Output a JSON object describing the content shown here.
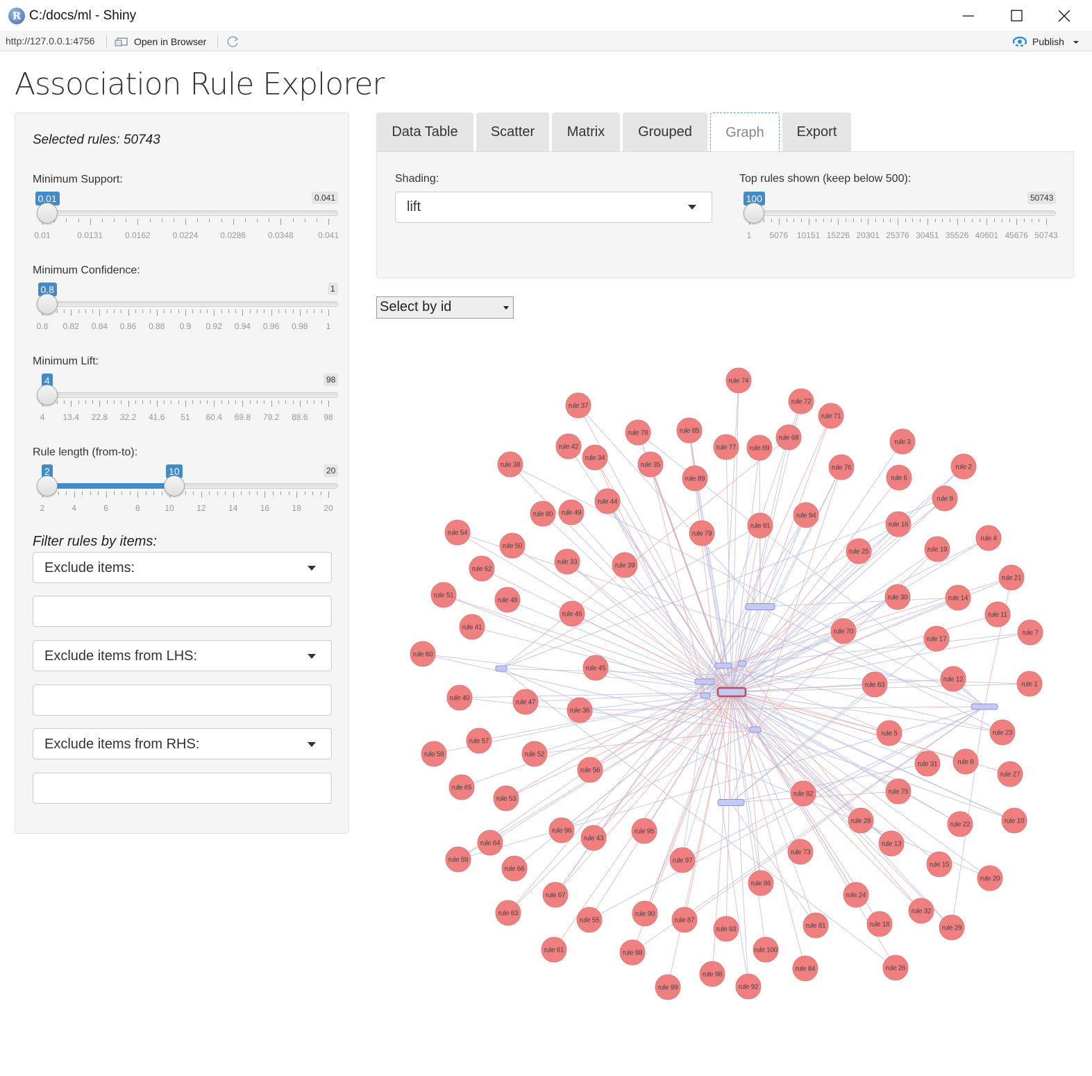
{
  "window": {
    "title": "C:/docs/ml - Shiny",
    "app_icon_letter": "R",
    "url": "http://127.0.0.1:4756",
    "open_in_browser": "Open in Browser",
    "publish": "Publish"
  },
  "page": {
    "title": "Association Rule Explorer"
  },
  "sidebar": {
    "selected_rules": "Selected rules: 50743",
    "min_support": {
      "label": "Minimum Support:",
      "value": "0.01",
      "max": "0.041",
      "value_fraction": 0.0,
      "ticks": [
        "0.01",
        "0.0131",
        "0.0162",
        "0.0224",
        "0.0286",
        "0.0348",
        "0.041"
      ]
    },
    "min_confidence": {
      "label": "Minimum Confidence:",
      "value": "0.8",
      "max": "1",
      "value_fraction": 0.0,
      "ticks": [
        "0.8",
        "0.82",
        "0.84",
        "0.86",
        "0.88",
        "0.9",
        "0.92",
        "0.94",
        "0.96",
        "0.98",
        "1"
      ]
    },
    "min_lift": {
      "label": "Minimum Lift:",
      "value": "4",
      "max": "98",
      "value_fraction": 0.0,
      "ticks": [
        "4",
        "13.4",
        "22.8",
        "32.2",
        "41.6",
        "51",
        "60.4",
        "69.8",
        "79.2",
        "88.6",
        "98"
      ]
    },
    "rule_length": {
      "label": "Rule length (from-to):",
      "from": "2",
      "to": "10",
      "max": "20",
      "from_fraction": 0.0,
      "to_fraction": 0.4444,
      "ticks": [
        "2",
        "4",
        "6",
        "8",
        "10",
        "12",
        "14",
        "16",
        "18",
        "20"
      ]
    },
    "filter_title": "Filter rules by items:",
    "exclude_items": "Exclude items:",
    "exclude_lhs": "Exclude items from LHS:",
    "exclude_rhs": "Exclude items from RHS:"
  },
  "tabs": [
    {
      "label": "Data Table",
      "active": false
    },
    {
      "label": "Scatter",
      "active": false
    },
    {
      "label": "Matrix",
      "active": false
    },
    {
      "label": "Grouped",
      "active": false
    },
    {
      "label": "Graph",
      "active": true
    },
    {
      "label": "Export",
      "active": false
    }
  ],
  "graph_options": {
    "shading_label": "Shading:",
    "shading_value": "lift",
    "top_rules_label": "Top rules shown (keep below 500):",
    "top_rules_value": "100",
    "top_rules_max": "50743",
    "top_rules_fraction": 0.0,
    "top_rules_ticks": [
      "1",
      "5076",
      "10151",
      "15226",
      "20301",
      "25376",
      "30451",
      "35526",
      "40601",
      "45676",
      "50743"
    ]
  },
  "select_by_id": "Select by id",
  "colors": {
    "accent": "#428bca",
    "rule_node": "#f08080",
    "item_node": "#c4c8f5",
    "edge_blue": "#b4b8e6",
    "edge_red": "#e6a8a8"
  },
  "network": {
    "rules": [
      {
        "label": "rule 74"
      },
      {
        "label": "rule 37"
      },
      {
        "label": "rule 72"
      },
      {
        "label": "rule 71"
      },
      {
        "label": "rule 78"
      },
      {
        "label": "rule 85"
      },
      {
        "label": "rule 68"
      },
      {
        "label": "rule 42"
      },
      {
        "label": "rule 34"
      },
      {
        "label": "rule 77"
      },
      {
        "label": "rule 69"
      },
      {
        "label": "rule 3"
      },
      {
        "label": "rule 38"
      },
      {
        "label": "rule 35"
      },
      {
        "label": "rule 89"
      },
      {
        "label": "rule 76"
      },
      {
        "label": "rule 2"
      },
      {
        "label": "rule 6"
      },
      {
        "label": "rule 44"
      },
      {
        "label": "rule 9"
      },
      {
        "label": "rule 80"
      },
      {
        "label": "rule 49"
      },
      {
        "label": "rule 94"
      },
      {
        "label": "rule 16"
      },
      {
        "label": "rule 54"
      },
      {
        "label": "rule 79"
      },
      {
        "label": "rule 91"
      },
      {
        "label": "rule 4"
      },
      {
        "label": "rule 50"
      },
      {
        "label": "rule 25"
      },
      {
        "label": "rule 19"
      },
      {
        "label": "rule 33"
      },
      {
        "label": "rule 39"
      },
      {
        "label": "rule 62"
      },
      {
        "label": "rule 21"
      },
      {
        "label": "rule 51"
      },
      {
        "label": "rule 48"
      },
      {
        "label": "rule 30"
      },
      {
        "label": "rule 14"
      },
      {
        "label": "rule 46"
      },
      {
        "label": "rule 11"
      },
      {
        "label": "rule 41"
      },
      {
        "label": "rule 70"
      },
      {
        "label": "rule 7"
      },
      {
        "label": "rule 17"
      },
      {
        "label": "rule 60"
      },
      {
        "label": "rule 45"
      },
      {
        "label": "rule 12"
      },
      {
        "label": "rule 83"
      },
      {
        "label": "rule 1"
      },
      {
        "label": "rule 40"
      },
      {
        "label": "rule 47"
      },
      {
        "label": "rule 36"
      },
      {
        "label": "rule 5"
      },
      {
        "label": "rule 23"
      },
      {
        "label": "rule 57"
      },
      {
        "label": "rule 58"
      },
      {
        "label": "rule 52"
      },
      {
        "label": "rule 31"
      },
      {
        "label": "rule 8"
      },
      {
        "label": "rule 56"
      },
      {
        "label": "rule 27"
      },
      {
        "label": "rule 65"
      },
      {
        "label": "rule 75"
      },
      {
        "label": "rule 53"
      },
      {
        "label": "rule 82"
      },
      {
        "label": "rule 28"
      },
      {
        "label": "rule 10"
      },
      {
        "label": "rule 96"
      },
      {
        "label": "rule 43"
      },
      {
        "label": "rule 95"
      },
      {
        "label": "rule 22"
      },
      {
        "label": "rule 64"
      },
      {
        "label": "rule 13"
      },
      {
        "label": "rule 73"
      },
      {
        "label": "rule 59"
      },
      {
        "label": "rule 66"
      },
      {
        "label": "rule 97"
      },
      {
        "label": "rule 15"
      },
      {
        "label": "rule 20"
      },
      {
        "label": "rule 86"
      },
      {
        "label": "rule 67"
      },
      {
        "label": "rule 24"
      },
      {
        "label": "rule 32"
      },
      {
        "label": "rule 63"
      },
      {
        "label": "rule 55"
      },
      {
        "label": "rule 90"
      },
      {
        "label": "rule 87"
      },
      {
        "label": "rule 93"
      },
      {
        "label": "rule 81"
      },
      {
        "label": "rule 18"
      },
      {
        "label": "rule 29"
      },
      {
        "label": "rule 61"
      },
      {
        "label": "rule 88"
      },
      {
        "label": "rule 100"
      },
      {
        "label": "rule 26"
      },
      {
        "label": "rule 84"
      },
      {
        "label": "rule 98"
      },
      {
        "label": "rule 99"
      },
      {
        "label": "rule 92"
      }
    ]
  }
}
